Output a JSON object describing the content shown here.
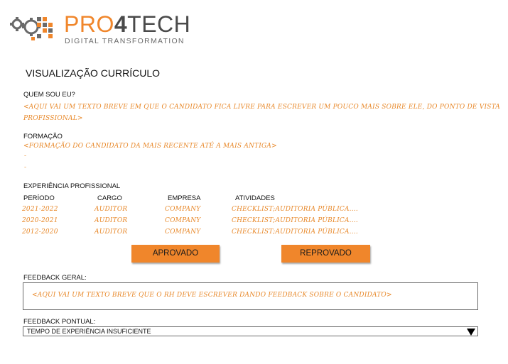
{
  "brand": {
    "name_part1": "PRO",
    "name_part2": "4",
    "name_part3": "TECH",
    "tagline": "DIGITAL TRANSFORMATION",
    "accent": "#f0862b",
    "dark": "#4a4a4a"
  },
  "page_title": "VISUALIZAÇÃO CURRÍCULO",
  "about": {
    "heading": "QUEM SOU EU?",
    "line1": "<AQUI VAI UM TEXTO BREVE EM QUE O CANDIDATO FICA LIVRE PARA ESCREVER UM POUCO MAIS SOBRE ELE, DO PONTO DE VISTA",
    "line2": "PROFISSIONAL>"
  },
  "education": {
    "heading": "FORMAÇÃO",
    "line1": "<FORMAÇÃO DO CANDIDATO DA MAIS RECENTE ATÉ A MAIS ANTIGA>",
    "line2": "-",
    "line3": "-"
  },
  "experience": {
    "heading": "EXPERIÊNCIA PROFISSIONAL",
    "columns": {
      "period": "PERÍODO",
      "role": "CARGO",
      "company": "EMPRESA",
      "activities": "ATIVIDADES"
    },
    "rows": [
      {
        "period": "2021-2022",
        "role": "AUDITOR",
        "company": "COMPANY",
        "activities": "CHECKLIST;AUDITORIA PÚBLICA...."
      },
      {
        "period": "2020-2021",
        "role": "AUDITOR",
        "company": "COMPANY",
        "activities": "CHECKLIST;AUDITORIA PÚBLICA...."
      },
      {
        "period": "2012-2020",
        "role": "AUDITOR",
        "company": "COMPANY",
        "activities": "CHECKLIST;AUDITORIA PÚBLICA...."
      }
    ]
  },
  "actions": {
    "approve_label": "APROVADO",
    "reject_label": "REPROVADO"
  },
  "feedback_general": {
    "label": "FEEDBACK GERAL:",
    "value": "<AQUI VAI UM TEXTO BREVE QUE O RH DEVE ESCREVER DANDO FEEDBACK SOBRE O CANDIDATO>"
  },
  "feedback_specific": {
    "label": "FEEDBACK PONTUAL:",
    "selected": "TEMPO DE EXPERIÊNCIA INSUFICIENTE",
    "icon": "triangle-down-icon"
  }
}
